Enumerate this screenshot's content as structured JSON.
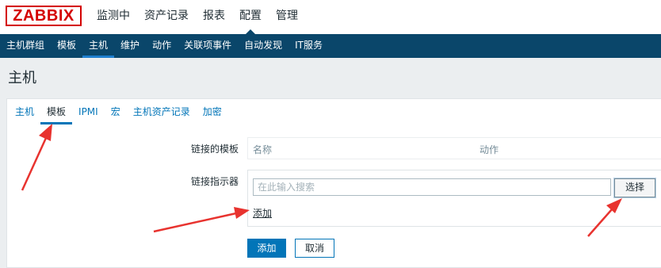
{
  "app": {
    "logo": "ZABBIX",
    "main_menu": [
      "监测中",
      "资产记录",
      "报表",
      "配置",
      "管理"
    ],
    "main_menu_active": 3,
    "sub_menu": [
      "主机群组",
      "模板",
      "主机",
      "维护",
      "动作",
      "关联项事件",
      "自动发现",
      "IT服务"
    ],
    "sub_menu_active": 2
  },
  "page": {
    "title": "主机"
  },
  "tabs": {
    "items": [
      "主机",
      "模板",
      "IPMI",
      "宏",
      "主机资产记录",
      "加密"
    ],
    "active": 1
  },
  "form": {
    "linked_templates_label": "链接的模板",
    "linked_table": {
      "col_name": "名称",
      "col_action": "动作"
    },
    "link_indicator_label": "链接指示器",
    "search_placeholder": "在此输入搜索",
    "select_button": "选择",
    "add_link": "添加"
  },
  "buttons": {
    "add": "添加",
    "cancel": "取消"
  },
  "colors": {
    "logo_red": "#d40000",
    "subnav_bg": "#0a466a",
    "link_blue": "#0275b8",
    "annotation_arrow": "#e8332f"
  }
}
